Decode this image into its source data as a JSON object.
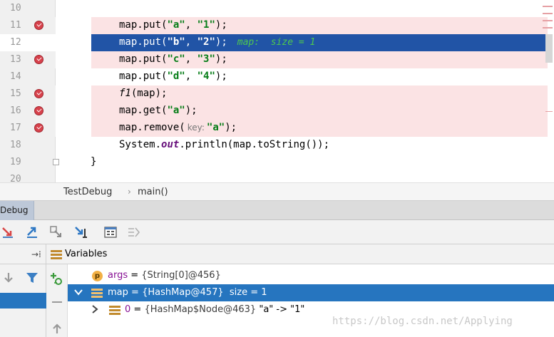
{
  "editor": {
    "lines": [
      {
        "num": "10",
        "breakpoint": false
      },
      {
        "num": "11",
        "breakpoint": true
      },
      {
        "num": "12",
        "breakpoint": false
      },
      {
        "num": "13",
        "breakpoint": true
      },
      {
        "num": "14",
        "breakpoint": false
      },
      {
        "num": "15",
        "breakpoint": true
      },
      {
        "num": "16",
        "breakpoint": true
      },
      {
        "num": "17",
        "breakpoint": true
      },
      {
        "num": "18",
        "breakpoint": false
      },
      {
        "num": "19",
        "breakpoint": false
      },
      {
        "num": "20",
        "breakpoint": false
      }
    ],
    "code": {
      "l11_pre": "map.put(",
      "l11_k": "\"a\"",
      "l11_mid": ", ",
      "l11_v": "\"1\"",
      "l11_post": ");",
      "l12_pre": "map.put(",
      "l12_k": "\"b\"",
      "l12_mid": ", ",
      "l12_v": "\"2\"",
      "l12_post": ");",
      "l12_inline": "map:  size = 1",
      "l13_pre": "map.put(",
      "l13_k": "\"c\"",
      "l13_mid": ", ",
      "l13_v": "\"3\"",
      "l13_post": ");",
      "l14_pre": "map.put(",
      "l14_k": "\"d\"",
      "l14_mid": ", ",
      "l14_v": "\"4\"",
      "l14_post": ");",
      "l15_fn": "f1",
      "l15_post": "(map);",
      "l16_pre": "map.get(",
      "l16_k": "\"a\"",
      "l16_post": ");",
      "l17_pre": "map.remove(",
      "l17_hint": "key:",
      "l17_k": "\"a\"",
      "l17_post": ");",
      "l18_pre": "System.",
      "l18_kw": "out",
      "l18_post": ".println(map.toString());",
      "l19": "}"
    }
  },
  "breadcrumb": {
    "class_name": "TestDebug",
    "separator": "›",
    "method": "main()"
  },
  "debug_tab": {
    "label": "Debug"
  },
  "variables": {
    "title": "Variables",
    "rows": [
      {
        "name": "args",
        "eq": " = ",
        "value": "{String[0]@456}"
      },
      {
        "name": "map",
        "eq": " = ",
        "value": "{HashMap@457}",
        "extra": "  size = 1"
      },
      {
        "name": "0",
        "eq": " = ",
        "value": "{HashMap$Node@463}",
        "extra": " \"a\" -> \"1\""
      }
    ]
  },
  "watermark": "https://blog.csdn.net/Applying",
  "colors": {
    "breakpoint_line": "#fbe3e4",
    "current_line": "#2154a6",
    "selected_row": "#2675bf",
    "string_green": "#067d17"
  }
}
